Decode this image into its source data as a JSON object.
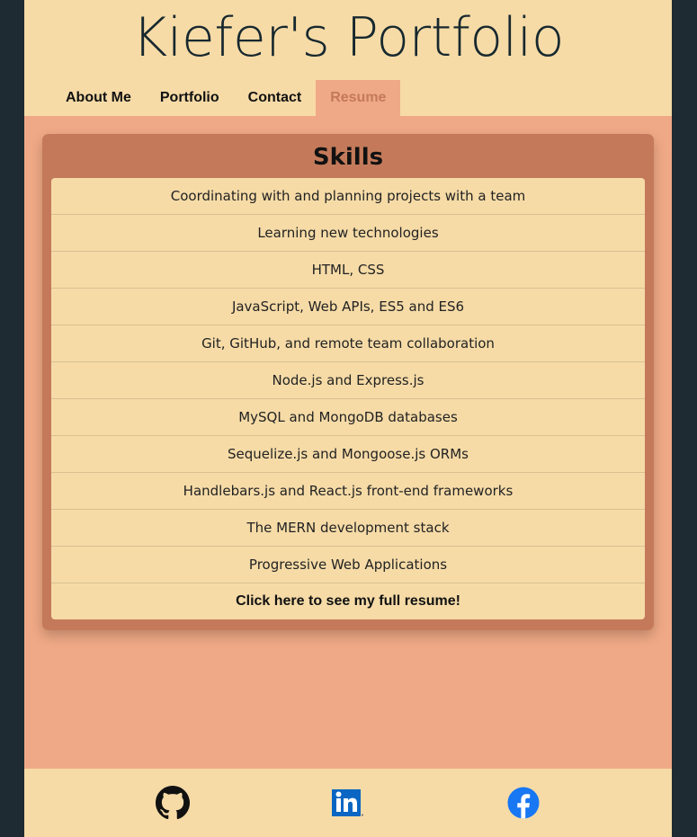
{
  "header": {
    "title": "Kiefer's Portfolio"
  },
  "nav": {
    "items": [
      {
        "label": "About Me"
      },
      {
        "label": "Portfolio"
      },
      {
        "label": "Contact"
      },
      {
        "label": "Resume",
        "active": true
      }
    ]
  },
  "skills_card": {
    "title": "Skills",
    "items": [
      "Coordinating with and planning projects with a team",
      "Learning new technologies",
      "HTML, CSS",
      "JavaScript, Web APIs, ES5 and ES6",
      "Git, GitHub, and remote team collaboration",
      "Node.js and Express.js",
      "MySQL and MongoDB databases",
      "Sequelize.js and Mongoose.js ORMs",
      "Handlebars.js and React.js front-end frameworks",
      "The MERN development stack",
      "Progressive Web Applications"
    ],
    "resume_link": "Click here to see my full resume!"
  },
  "footer": {
    "links": [
      {
        "icon": "github-icon"
      },
      {
        "icon": "linkedin-icon"
      },
      {
        "icon": "facebook-icon"
      }
    ]
  },
  "colors": {
    "outer_background": "#1e2b32",
    "header_footer": "#f6dba7",
    "main_background": "#f0a986",
    "card": "#c47a5a",
    "active_nav_text": "#c47a5a",
    "linkedin_blue": "#0a66c2",
    "facebook_blue": "#1877f2"
  }
}
